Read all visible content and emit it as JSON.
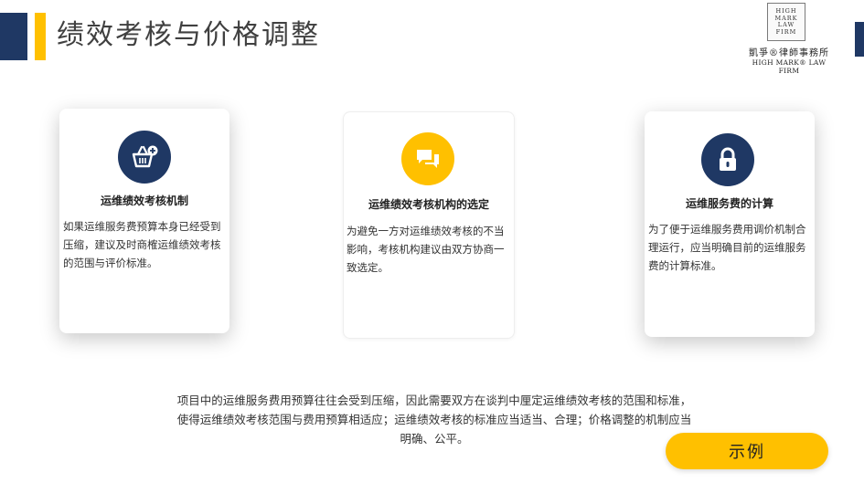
{
  "header": {
    "title": "绩效考核与价格调整"
  },
  "logo": {
    "box_lines": [
      "HIGH",
      "MARK",
      "LAW",
      "FIRM"
    ],
    "name_cn": "凱爭®律師事務所",
    "name_en": "HIGH MARK® LAW FIRM"
  },
  "cards": [
    {
      "icon": "basket-add-icon",
      "title": "运维绩效考核机制",
      "text": "如果运维服务费预算本身已经受到压缩，建议及时商榷运维绩效考核的范围与评价标准。"
    },
    {
      "icon": "chat-bubbles-icon",
      "title": "运维绩效考核机构的选定",
      "text": "为避免一方对运维绩效考核的不当影响，考核机构建议由双方协商一致选定。"
    },
    {
      "icon": "lock-icon",
      "title": "运维服务费的计算",
      "text": "为了便于运维服务费用调价机制合理运行，应当明确目前的运维服务费的计算标准。"
    }
  ],
  "summary": "项目中的运维服务费用预算往往会受到压缩，因此需要双方在谈判中厘定运维绩效考核的范围和标准，使得运维绩效考核范围与费用预算相适应；运维绩效考核的标准应当适当、合理；价格调整的机制应当明确、公平。",
  "example_button": {
    "label": "示例"
  },
  "colors": {
    "navy": "#1f3864",
    "yellow": "#ffc000"
  }
}
